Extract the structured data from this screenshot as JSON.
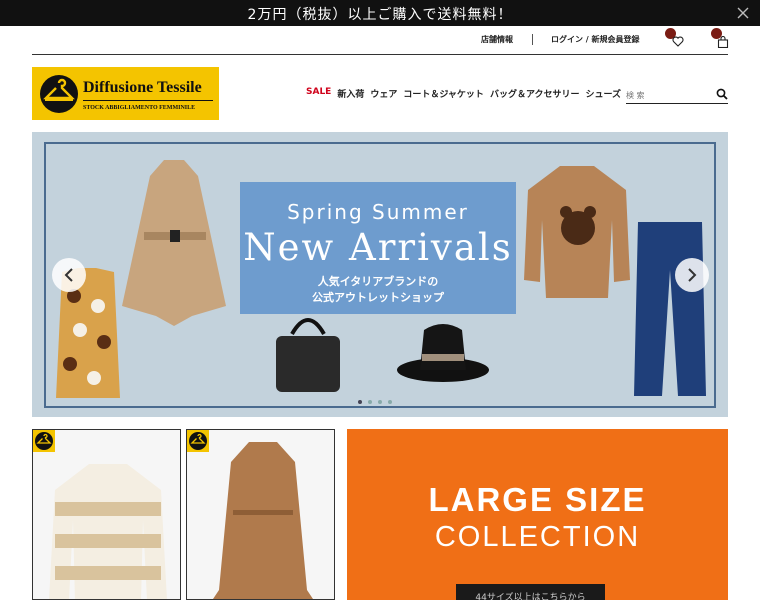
{
  "topbar": {
    "message": "2万円（税抜）以上ご購入で送料無料！",
    "close_icon": "close-icon"
  },
  "util": {
    "store_label": "店舗情報",
    "login_label": "ログイン / 新規会員登録",
    "favorites_icon": "heart-icon",
    "cart_icon": "bag-icon",
    "badge_color": "#7a1c14"
  },
  "logo": {
    "name": "Diffusione Tessile",
    "tagline": "STOCK ABBIGLIAMENTO FEMMINILE",
    "color": "#f4c400"
  },
  "nav": {
    "items": [
      "SALE",
      "新入荷",
      "ウェア",
      "コート＆ジャケット",
      "バッグ＆アクセサリー",
      "シューズ"
    ],
    "sale_color": "#d0021b"
  },
  "search": {
    "placeholder": "検 索"
  },
  "hero": {
    "line1": "Spring Summer",
    "line2": "New Arrivals",
    "line3": "人気イタリアブランドの",
    "line4": "公式アウトレットショップ",
    "panel_color": "#6e9cce",
    "slide_count": 4,
    "active_slide": 1
  },
  "cards": [
    {
      "name": "knit-sweater-card",
      "badge_icon": "hanger-badge-icon"
    },
    {
      "name": "dress-card",
      "badge_icon": "hanger-badge-icon"
    }
  ],
  "promo": {
    "line1": "LARGE SIZE",
    "line2": "COLLECTION",
    "button": "44サイズ以上はこちらから",
    "color": "#f06f16"
  }
}
